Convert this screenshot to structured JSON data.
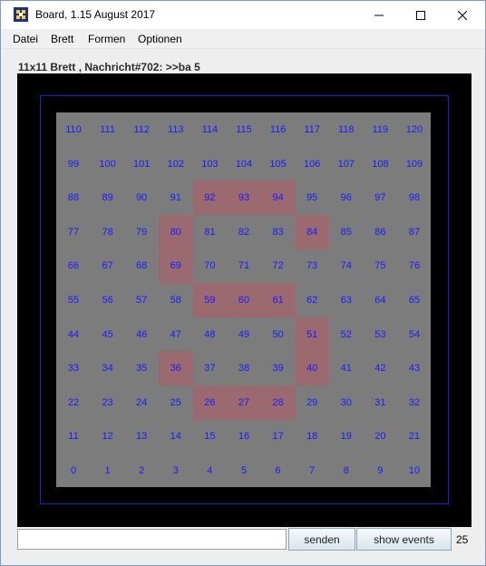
{
  "window": {
    "title": "Board, 1.15 August 2017"
  },
  "menu": {
    "items": [
      "Datei",
      "Brett",
      "Formen",
      "Optionen"
    ]
  },
  "board": {
    "caption": "11x11 Brett , Nachricht#702: >>ba 5",
    "size": 11,
    "highlighted": [
      92,
      93,
      94,
      80,
      84,
      69,
      59,
      60,
      61,
      51,
      36,
      40,
      26,
      27,
      28
    ],
    "colors": {
      "background": "#000000",
      "frame": "#2222cc",
      "cell": "#7c7c7c",
      "highlight": "#9a6a70",
      "label": "#1a1aff"
    }
  },
  "bottom": {
    "input_value": "",
    "send_label": "senden",
    "events_label": "show events",
    "counter": "25"
  }
}
